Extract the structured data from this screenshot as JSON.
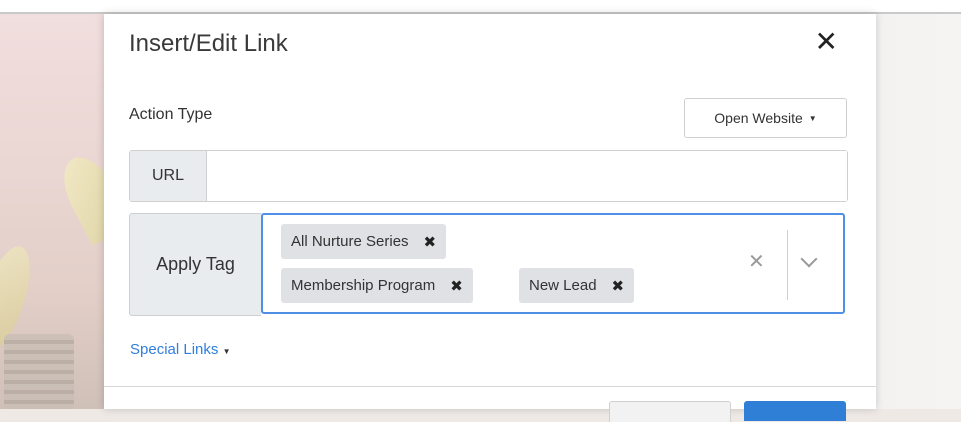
{
  "modal": {
    "title": "Insert/Edit Link",
    "close_glyph": "✕"
  },
  "action_type": {
    "label": "Action Type",
    "selected": "Open Website"
  },
  "url": {
    "label": "URL",
    "value": ""
  },
  "apply_tag": {
    "label": "Apply Tag",
    "tags": [
      "All Nurture Series",
      "Membership Program",
      "New Lead"
    ],
    "remove_glyph": "✖",
    "clear_glyph": "✕"
  },
  "special_links": {
    "label": "Special Links"
  },
  "colors": {
    "link": "#2f7fdc",
    "focus_border": "#4f8fe6",
    "primary_button": "#2f7fd6"
  }
}
